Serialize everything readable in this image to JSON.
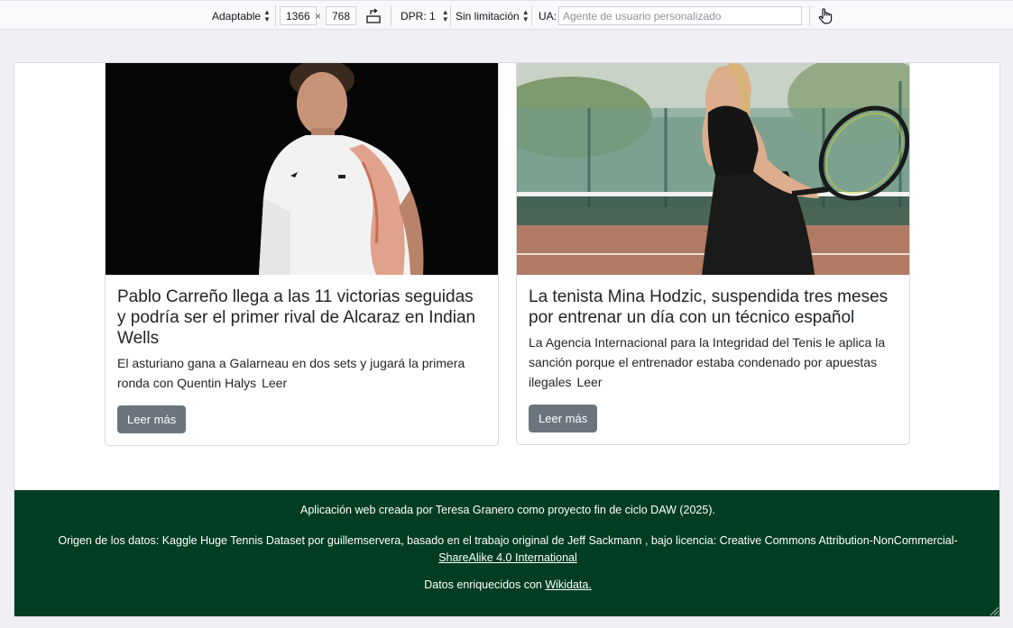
{
  "toolbar": {
    "device": "Adaptable",
    "width": "1366",
    "times": "×",
    "height": "768",
    "dpr": "DPR: 1",
    "throttle": "Sin limitación",
    "ua_label": "UA:",
    "ua_placeholder": "Agente de usuario personalizado"
  },
  "cards": [
    {
      "title": "Pablo Carreño llega a las 11 victorias seguidas y podría ser el primer rival de Alcaraz en Indian Wells",
      "text": "El asturiano gana a Galarneau en dos sets y jugará la primera ronda con Quentin Halys",
      "link": "Leer",
      "button": "Leer más"
    },
    {
      "title": "La tenista Mina Hodzic, suspendida tres meses por entrenar un día con un técnico español",
      "text": "La Agencia Internacional para la Integridad del Tenis le aplica la sanción porque el entrenador estaba condenado por apuestas ilegales",
      "link": "Leer",
      "button": "Leer más"
    }
  ],
  "footer": {
    "line1": "Aplicación web creada por Teresa Granero como proyecto fin de ciclo DAW (2025).",
    "line2_prefix": "Origen de los datos: Kaggle Huge Tennis Dataset por guillemservera, basado en el trabajo original de Jeff Sackmann , bajo licencia: Creative Commons Attribution-NonCommercial-",
    "line2_link": "ShareAlike 4.0 International",
    "line3_prefix": "Datos enriquecidos con",
    "line3_link": "Wikidata."
  }
}
